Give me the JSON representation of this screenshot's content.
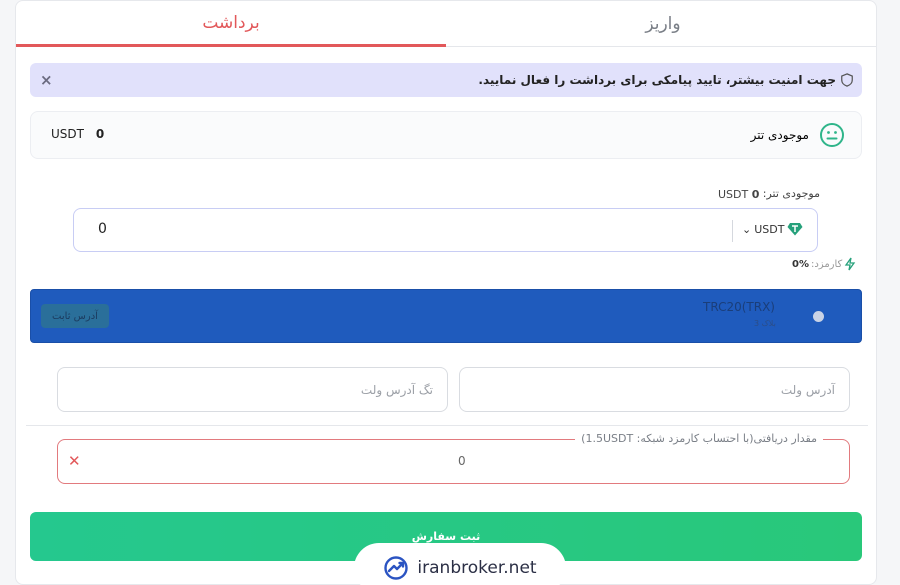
{
  "tabs": {
    "deposit": "واریز",
    "withdraw": "برداشت"
  },
  "alert": {
    "text": "جهت امنیت بیشتر، تایید پیامکی برای برداشت را فعال نمایید.",
    "close": "×"
  },
  "balance": {
    "label": "موجودی تتر",
    "amount": "0",
    "currency": "USDT"
  },
  "available": {
    "label": "موجودی تتر:",
    "amount": "0",
    "currency": "USDT"
  },
  "amount_input": {
    "value": "0",
    "currency": "USDT"
  },
  "fee": {
    "label": "کارمزد:",
    "value": "0%"
  },
  "network": {
    "name": "TRC20(TRX)",
    "confirmations": "3 بلاک",
    "tag": "آدرس ثابت"
  },
  "fields": {
    "wallet_address_placeholder": "آدرس ولت",
    "wallet_tag_placeholder": "تگ آدرس ولت"
  },
  "receive": {
    "legend": "مقدار دریافتی(با احتساب کارمزد شبکه: 1.5USDT)",
    "value": "0",
    "clear": "✕"
  },
  "submit": {
    "label": "ثبت سفارش"
  },
  "watermark": {
    "text": "iranbroker.net"
  },
  "colors": {
    "accent_red": "#e2585a",
    "network_blue": "#1f5bbd",
    "submit_green": "#27c884",
    "tether_green": "#26a17b"
  }
}
